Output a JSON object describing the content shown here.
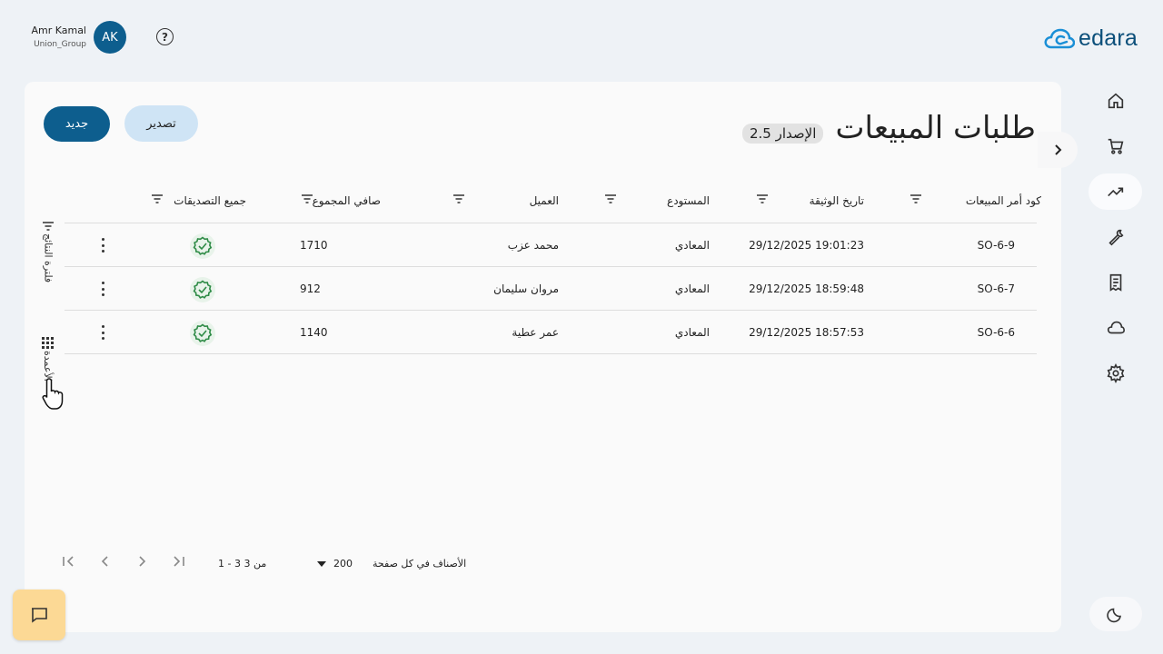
{
  "header": {
    "user_name": "Amr Kamal",
    "user_org": "Union_Group",
    "avatar_initials": "AK",
    "help_label": "?",
    "logo_text": "edara"
  },
  "nav": {
    "items": [
      {
        "icon": "home-icon"
      },
      {
        "icon": "cart-icon"
      },
      {
        "icon": "trending-up-icon",
        "active": true
      },
      {
        "icon": "wrench-icon"
      },
      {
        "icon": "receipt-icon"
      },
      {
        "icon": "cloud-icon"
      },
      {
        "icon": "gear-icon"
      }
    ]
  },
  "page": {
    "title": "طلبات المبيعات",
    "version": "الإصدار 2.5",
    "new_button": "جديد",
    "export_button": "تصدير",
    "side_filter_label": "فلترة النتائج",
    "side_columns_label": "الأعمدة"
  },
  "table": {
    "columns": [
      {
        "label": "كود أمر المبيعات"
      },
      {
        "label": "تاريخ الوثيقة"
      },
      {
        "label": "المستودع"
      },
      {
        "label": "العميل"
      },
      {
        "label": "صافي المجموع"
      },
      {
        "label": "جميع التصديقات"
      }
    ],
    "rows": [
      {
        "code": "SO-6-9",
        "date": "29/12/2025 19:01:23",
        "warehouse": "المعادي",
        "customer": "محمد عزب",
        "net_total": "1710"
      },
      {
        "code": "SO-6-7",
        "date": "29/12/2025 18:59:48",
        "warehouse": "المعادي",
        "customer": "مروان سليمان",
        "net_total": "912"
      },
      {
        "code": "SO-6-6",
        "date": "29/12/2025 18:57:53",
        "warehouse": "المعادي",
        "customer": "عمر عطية",
        "net_total": "1140"
      }
    ]
  },
  "pagination": {
    "items_per_page_label": "الأصناف في كل صفحة",
    "page_size": "200",
    "range_text": "1 - 3 من 3"
  },
  "colors": {
    "primary": "#0d5e8e",
    "export_bg": "#cfe4f5",
    "chat_bg": "#fcd995",
    "approval_green": "#2e8b46"
  }
}
